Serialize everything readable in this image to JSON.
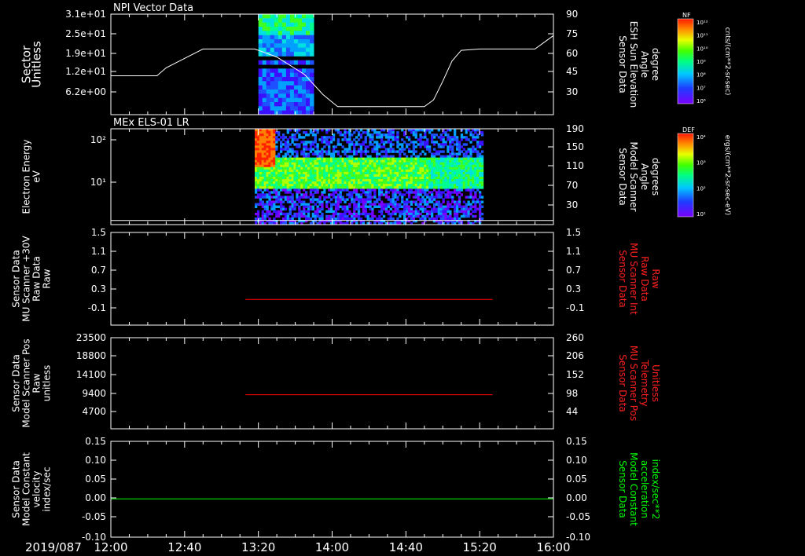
{
  "date_label": "2019/087",
  "x_axis": {
    "tick_labels": [
      "12:00",
      "12:40",
      "13:20",
      "14:00",
      "14:40",
      "15:20",
      "16:00"
    ],
    "start_min": 0,
    "end_min": 240,
    "major_step_min": 40,
    "minor_step_min": 10
  },
  "colors": {
    "white": "#ffffff",
    "red": "#ff0000",
    "green": "#00ff00",
    "background": "#000000"
  },
  "colorbars": [
    {
      "label": "NF",
      "ticks": [
        "10¹²",
        "10¹¹",
        "10¹⁰",
        "10⁹",
        "10⁸",
        "10⁷",
        "10⁶"
      ],
      "units": "cnts/(cm**2-sr-sec)"
    },
    {
      "label": "DEF",
      "ticks": [
        "10⁴",
        "10³",
        "10²",
        "10¹"
      ],
      "units": "ergs/(cm**2-sr-sec-eV)"
    }
  ],
  "chart_data": [
    {
      "type": "heatmap",
      "title": "NPI Vector Data",
      "left_label": [
        "Sector",
        "Unitless"
      ],
      "left_ticks": [
        "3.1e+01",
        "2.5e+01",
        "1.9e+01",
        "1.2e+01",
        "6.2e+00"
      ],
      "right_label": [
        "Sensor Data",
        "ESH Sun Elevation",
        "Angle",
        "degree"
      ],
      "right_ticks": [
        "90",
        "75",
        "60",
        "45",
        "30"
      ],
      "ylim": [
        0,
        31
      ],
      "right_ylim": [
        15,
        90
      ],
      "heatmap_x_range_min": [
        80,
        110
      ],
      "line_series": {
        "color": "white",
        "x_min": [
          0,
          15,
          25,
          30,
          50,
          57,
          62,
          67,
          73,
          78,
          82,
          90,
          105,
          115,
          123,
          128,
          133,
          138,
          143,
          150,
          155,
          160,
          170,
          175,
          180,
          185,
          190,
          200,
          210,
          220,
          230,
          235,
          240
        ],
        "y_deg": [
          44,
          44,
          44,
          50,
          64,
          64,
          64,
          64,
          64,
          64,
          62,
          58,
          45,
          30,
          21,
          21,
          21,
          21,
          21,
          21,
          21,
          21,
          21,
          26,
          40,
          55,
          63,
          64,
          64,
          64,
          64,
          69,
          74
        ]
      }
    },
    {
      "type": "heatmap",
      "title": "MEx ELS-01 LR",
      "left_label": [
        "Electron Energy",
        "eV"
      ],
      "left_ticks": [
        "10²",
        "10¹"
      ],
      "right_label": [
        "Sensor Data",
        "Model Scanner",
        "Angle",
        "degrees"
      ],
      "right_ticks": [
        "190",
        "150",
        "110",
        "70",
        "30"
      ],
      "right_ylim": [
        5,
        190
      ],
      "heatmap_x_range_min": [
        78,
        202
      ],
      "line_series": {
        "color": "white",
        "x_min": [
          0,
          240
        ],
        "y_deg": [
          13,
          13
        ]
      }
    },
    {
      "type": "line",
      "left_label": [
        "Sensor Data",
        "MU Scanner +30V",
        "Raw Data",
        "Raw"
      ],
      "left_ticks": [
        "1.5",
        "1.1",
        "0.7",
        "0.3",
        "-0.1"
      ],
      "right_label": [
        "Sensor Data",
        "MU Scanner Int",
        "Raw Data",
        "Raw"
      ],
      "right_ticks": [
        "1.5",
        "1.1",
        "0.7",
        "0.3",
        "-0.1"
      ],
      "ylim": [
        -0.3,
        1.5
      ],
      "series": [
        {
          "color": "red",
          "x_min": [
            73,
            207
          ],
          "values": [
            0.2,
            0.2
          ]
        }
      ]
    },
    {
      "type": "line",
      "left_label": [
        "Sensor Data",
        "Model Scanner Pos",
        "Raw",
        "unitless"
      ],
      "left_ticks": [
        "23500",
        "18800",
        "14100",
        "9400",
        "4700"
      ],
      "right_label": [
        "Sensor Data",
        "MU Scanner Pos",
        "Telemetry",
        "Unitless"
      ],
      "right_ticks": [
        "260",
        "206",
        "152",
        "98",
        "44"
      ],
      "ylim": [
        0,
        23500
      ],
      "series": [
        {
          "color": "red",
          "x_min": [
            73,
            207
          ],
          "values": [
            8800,
            8800
          ]
        }
      ]
    },
    {
      "type": "line",
      "left_label": [
        "Sensor Data",
        "Model Constant",
        "velocity",
        "index/sec"
      ],
      "left_ticks": [
        "0.15",
        "0.10",
        "0.05",
        "0.00",
        "-0.05",
        "-0.10"
      ],
      "right_label": [
        "Sensor Data",
        "Model Constant",
        "acceleration",
        "index/sec**2"
      ],
      "right_ticks": [
        "0.15",
        "0.10",
        "0.05",
        "0.00",
        "-0.05",
        "-0.10"
      ],
      "ylim": [
        -0.1,
        0.15
      ],
      "series": [
        {
          "color": "green",
          "x_min": [
            0,
            240
          ],
          "values": [
            0.0,
            0.0
          ]
        }
      ]
    }
  ]
}
